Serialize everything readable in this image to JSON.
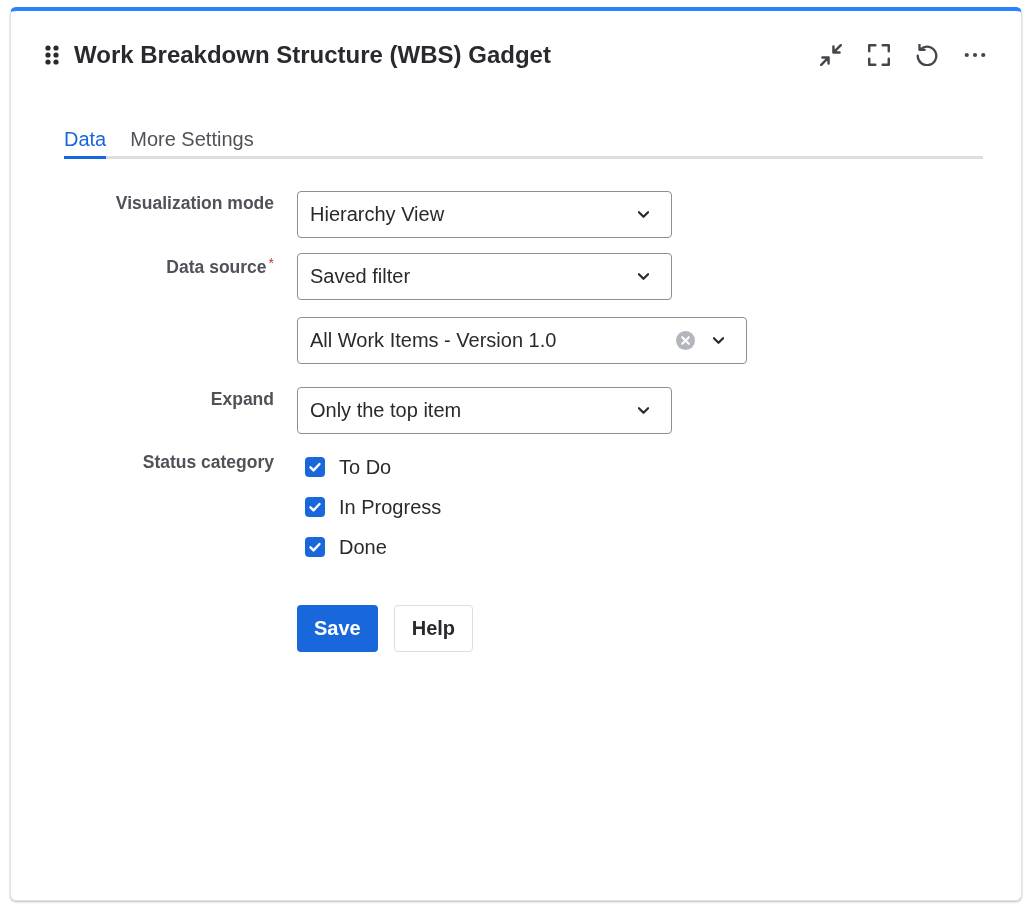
{
  "gadget": {
    "title": "Work Breakdown Structure (WBS) Gadget"
  },
  "tabs": [
    {
      "label": "Data",
      "selected": true
    },
    {
      "label": "More Settings",
      "selected": false
    }
  ],
  "form": {
    "rows": [
      {
        "label": "Visualization mode",
        "kind": "select",
        "value": "Hierarchy View"
      },
      {
        "label": "Data source",
        "required_marker": "*",
        "kind": "select",
        "value": "Saved filter"
      },
      {
        "kind": "picker",
        "value": "All Work Items - Version 1.0"
      },
      {
        "label": "Expand",
        "kind": "select",
        "value": "Only the top item"
      },
      {
        "label": "Status category",
        "kind": "checkboxes",
        "options": [
          {
            "label": "To Do",
            "checked": true
          },
          {
            "label": "In Progress",
            "checked": true
          },
          {
            "label": "Done",
            "checked": true
          }
        ]
      }
    ]
  },
  "buttons": [
    {
      "label": "Save",
      "kind": "primary"
    },
    {
      "label": "Help",
      "kind": "default"
    }
  ]
}
